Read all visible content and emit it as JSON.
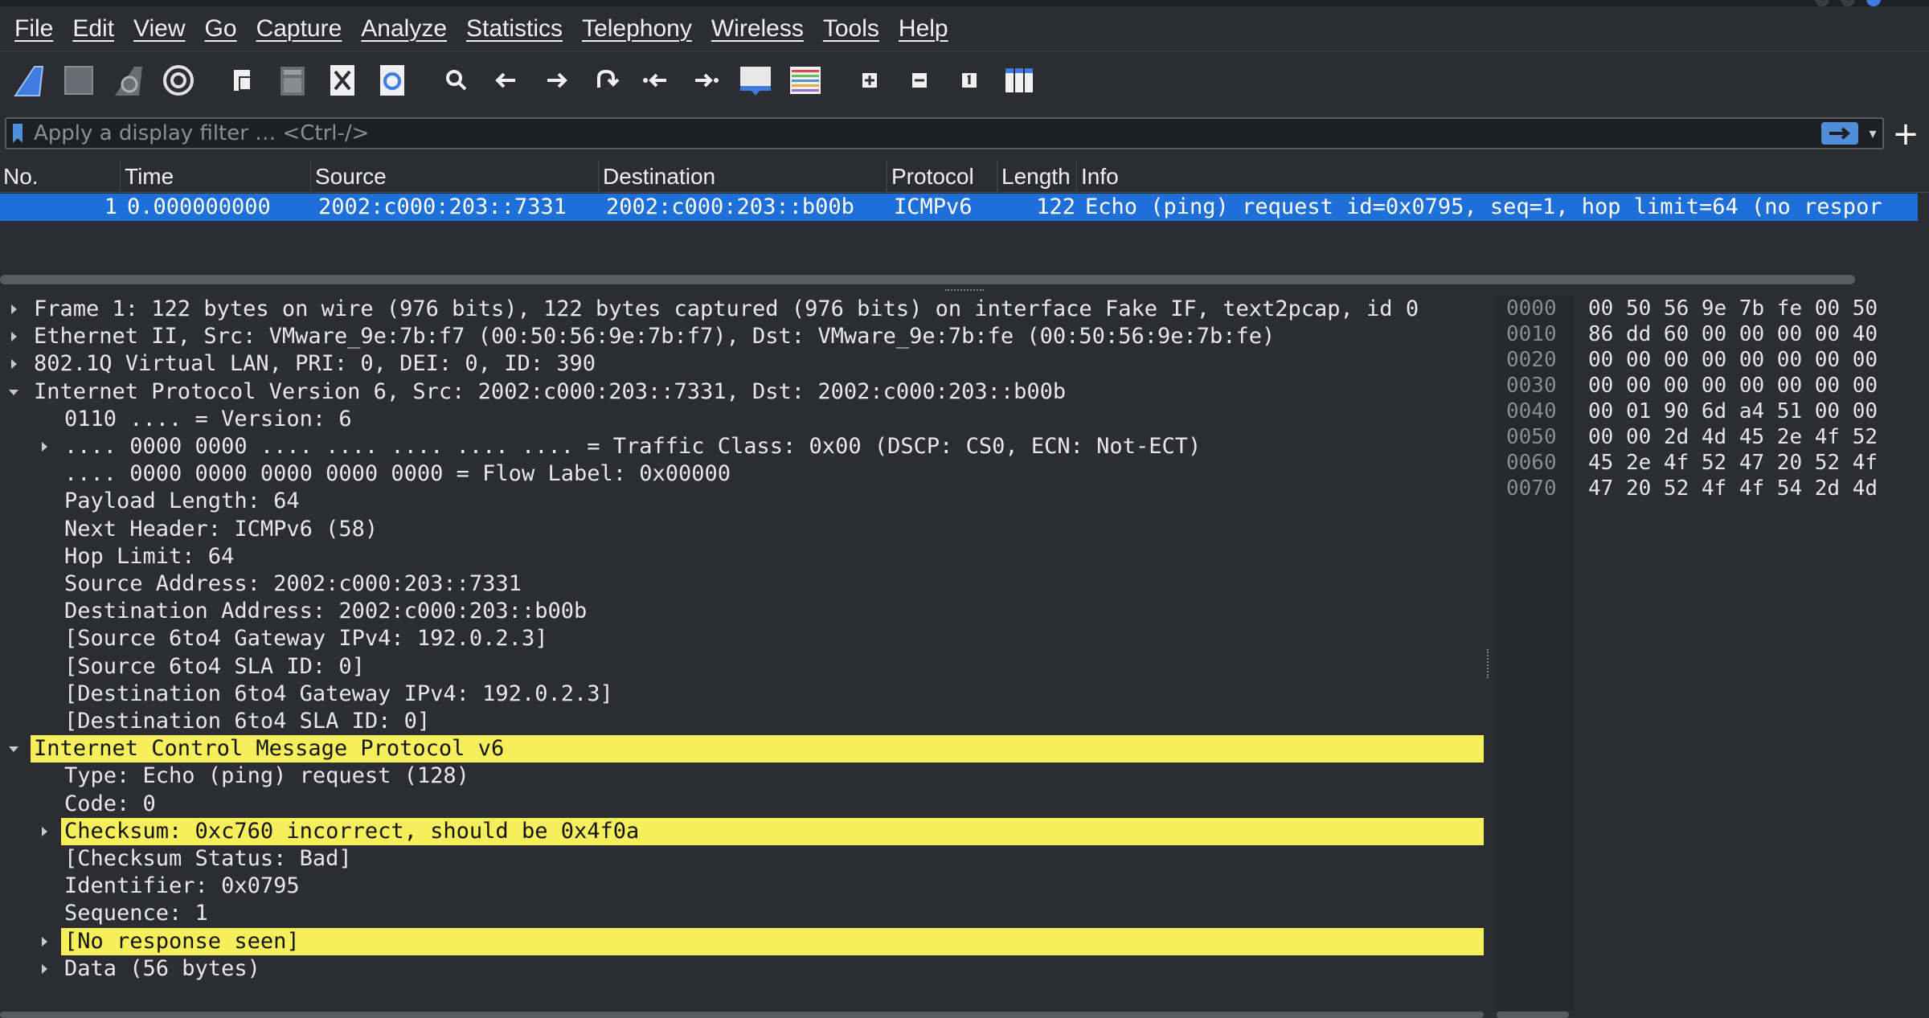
{
  "menu": [
    "File",
    "Edit",
    "View",
    "Go",
    "Capture",
    "Analyze",
    "Statistics",
    "Telephony",
    "Wireless",
    "Tools",
    "Help"
  ],
  "toolbar": {
    "icons": [
      "shark-fin-start-icon",
      "stop-square-icon",
      "restart-fin-icon",
      "capture-options-gear-icon",
      "open-file-icon",
      "save-file-icon",
      "close-file-icon",
      "reload-file-icon",
      "find-magnifier-icon",
      "go-back-arrow-icon",
      "go-forward-arrow-icon",
      "go-to-packet-icon",
      "first-packet-icon",
      "last-packet-icon",
      "autoscroll-icon",
      "colorize-icon",
      "zoom-in-icon",
      "zoom-out-icon",
      "normal-size-icon",
      "resize-columns-icon"
    ]
  },
  "filter": {
    "placeholder": "Apply a display filter … <Ctrl-/>",
    "apply_icon": "arrow-right-icon",
    "add_label": "+"
  },
  "packet_list": {
    "columns": [
      "No.",
      "Time",
      "Source",
      "Destination",
      "Protocol",
      "Length",
      "Info"
    ],
    "rows": [
      {
        "no": "1",
        "time": "0.000000000",
        "source": "2002:c000:203::7331",
        "destination": "2002:c000:203::b00b",
        "protocol": "ICMPv6",
        "length": "122",
        "info": "Echo (ping) request id=0x0795, seq=1, hop limit=64 (no respor"
      }
    ]
  },
  "details": {
    "rows": [
      {
        "level": 0,
        "expander": "collapsed",
        "text": "Frame 1: 122 bytes on wire (976 bits), 122 bytes captured (976 bits) on interface Fake IF, text2pcap, id 0"
      },
      {
        "level": 0,
        "expander": "collapsed",
        "text": "Ethernet II, Src: VMware_9e:7b:f7 (00:50:56:9e:7b:f7), Dst: VMware_9e:7b:fe (00:50:56:9e:7b:fe)"
      },
      {
        "level": 0,
        "expander": "collapsed",
        "text": "802.1Q Virtual LAN, PRI: 0, DEI: 0, ID: 390"
      },
      {
        "level": 0,
        "expander": "expanded",
        "text": "Internet Protocol Version 6, Src: 2002:c000:203::7331, Dst: 2002:c000:203::b00b"
      },
      {
        "level": 1,
        "expander": "none",
        "text": "0110 .... = Version: 6"
      },
      {
        "level": 1,
        "expander": "collapsed",
        "text": ".... 0000 0000 .... .... .... .... .... = Traffic Class: 0x00 (DSCP: CS0, ECN: Not-ECT)"
      },
      {
        "level": 1,
        "expander": "none",
        "text": ".... 0000 0000 0000 0000 0000 = Flow Label: 0x00000"
      },
      {
        "level": 1,
        "expander": "none",
        "text": "Payload Length: 64"
      },
      {
        "level": 1,
        "expander": "none",
        "text": "Next Header: ICMPv6 (58)"
      },
      {
        "level": 1,
        "expander": "none",
        "text": "Hop Limit: 64"
      },
      {
        "level": 1,
        "expander": "none",
        "text": "Source Address: 2002:c000:203::7331"
      },
      {
        "level": 1,
        "expander": "none",
        "text": "Destination Address: 2002:c000:203::b00b"
      },
      {
        "level": 1,
        "expander": "none",
        "text": "[Source 6to4 Gateway IPv4: 192.0.2.3]"
      },
      {
        "level": 1,
        "expander": "none",
        "text": "[Source 6to4 SLA ID: 0]"
      },
      {
        "level": 1,
        "expander": "none",
        "text": "[Destination 6to4 Gateway IPv4: 192.0.2.3]"
      },
      {
        "level": 1,
        "expander": "none",
        "text": "[Destination 6to4 SLA ID: 0]"
      },
      {
        "level": 0,
        "expander": "expanded",
        "highlight": true,
        "text": "Internet Control Message Protocol v6"
      },
      {
        "level": 1,
        "expander": "none",
        "text": "Type: Echo (ping) request (128)"
      },
      {
        "level": 1,
        "expander": "none",
        "text": "Code: 0"
      },
      {
        "level": 1,
        "expander": "collapsed",
        "highlight": true,
        "text": "Checksum: 0xc760 incorrect, should be 0x4f0a"
      },
      {
        "level": 1,
        "expander": "none",
        "text": "[Checksum Status: Bad]"
      },
      {
        "level": 1,
        "expander": "none",
        "text": "Identifier: 0x0795"
      },
      {
        "level": 1,
        "expander": "none",
        "text": "Sequence: 1"
      },
      {
        "level": 1,
        "expander": "collapsed",
        "highlight": true,
        "text": "[No response seen]"
      },
      {
        "level": 1,
        "expander": "collapsed",
        "text": "Data (56 bytes)"
      }
    ]
  },
  "bytes": {
    "offsets": [
      "0000",
      "0010",
      "0020",
      "0030",
      "0040",
      "0050",
      "0060",
      "0070"
    ],
    "hex": [
      "00 50 56 9e 7b fe 00 50",
      "86 dd 60 00 00 00 00 40",
      "00 00 00 00 00 00 00 00",
      "00 00 00 00 00 00 00 00",
      "00 01 90 6d a4 51 00 00",
      "00 00 2d 4d 45 2e 4f 52",
      "45 2e 4f 52 47 20 52 4f",
      "47 20 52 4f 4f 54 2d 4d"
    ]
  },
  "colors": {
    "selected_row": "#1f6fd8",
    "warning_highlight": "#f4ef5a",
    "background": "#2b2d31"
  }
}
